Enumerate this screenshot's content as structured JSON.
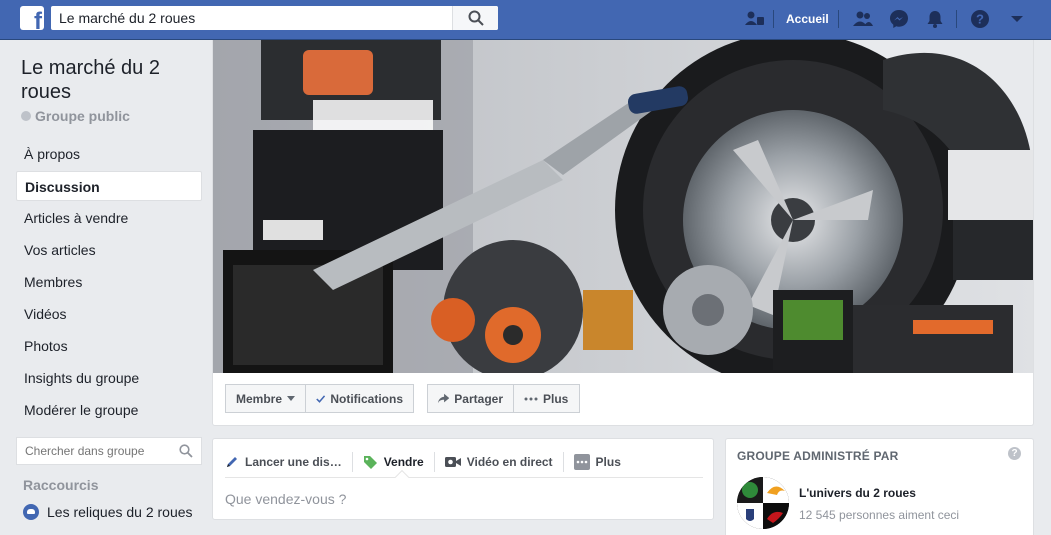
{
  "topbar": {
    "search_value": "Le marché du 2 roues",
    "home_label": "Accueil",
    "icons": [
      "find-friends-icon",
      "friends-icon",
      "messenger-icon",
      "notifications-icon",
      "help-icon",
      "menu-caret-icon"
    ],
    "brand_color": "#4267b2"
  },
  "group": {
    "title": "Le marché du 2 roues",
    "type": "Groupe public"
  },
  "nav": {
    "items": [
      "À propos",
      "Discussion",
      "Articles à vendre",
      "Vos articles",
      "Membres",
      "Vidéos",
      "Photos",
      "Insights du groupe",
      "Modérer le groupe"
    ],
    "active": "Discussion"
  },
  "left_search": {
    "placeholder": "Chercher dans groupe"
  },
  "shortcuts": {
    "heading": "Raccourcis",
    "items": [
      "Les reliques du 2 roues"
    ]
  },
  "cover_actions": {
    "member": "Membre",
    "notifications": "Notifications",
    "share": "Partager",
    "more": "Plus"
  },
  "composer": {
    "tabs": [
      "Lancer une dis…",
      "Vendre",
      "Vidéo en direct",
      "Plus"
    ],
    "active_tab": "Vendre",
    "placeholder": "Que vendez-vous ?"
  },
  "admin": {
    "heading": "GROUPE ADMINISTRÉ PAR",
    "page_name": "L'univers du 2 roues",
    "page_likes": "12 545 personnes aiment ceci"
  }
}
